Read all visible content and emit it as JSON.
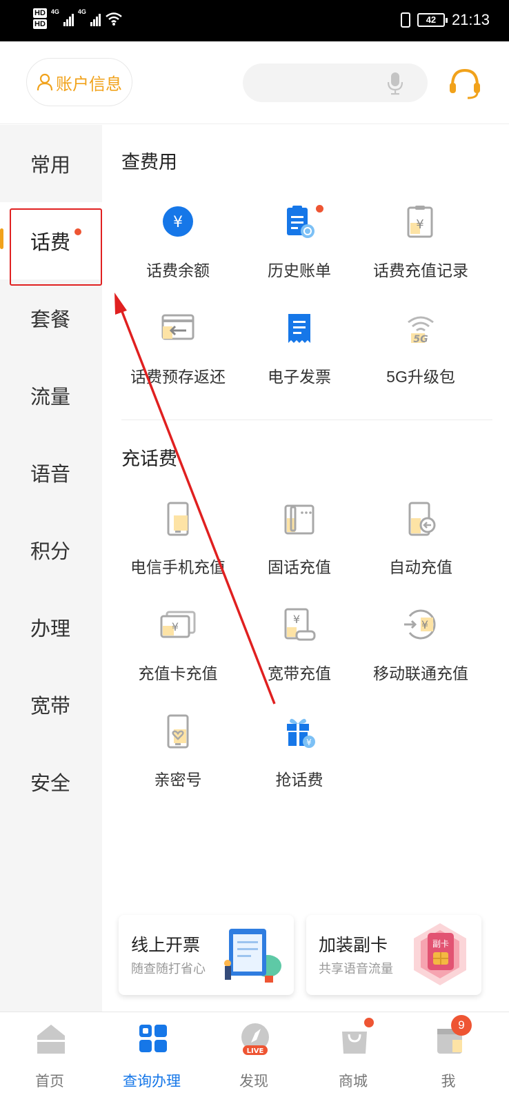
{
  "status_bar": {
    "hd1": "HD",
    "hd2": "HD",
    "net1": "4G",
    "net2": "4G",
    "battery": "42",
    "time": "21:13"
  },
  "header": {
    "account_label": "账户信息"
  },
  "sidebar": {
    "items": [
      {
        "label": "常用"
      },
      {
        "label": "话费"
      },
      {
        "label": "套餐"
      },
      {
        "label": "流量"
      },
      {
        "label": "语音"
      },
      {
        "label": "积分"
      },
      {
        "label": "办理"
      },
      {
        "label": "宽带"
      },
      {
        "label": "安全"
      }
    ],
    "active_index": 1
  },
  "sections": [
    {
      "title": "查费用",
      "items": [
        {
          "label": "话费余额",
          "icon": "yuan-circle-icon"
        },
        {
          "label": "历史账单",
          "icon": "bill-history-icon"
        },
        {
          "label": "话费充值记录",
          "icon": "recharge-record-icon"
        },
        {
          "label": "话费预存返还",
          "icon": "prestore-return-icon"
        },
        {
          "label": "电子发票",
          "icon": "e-invoice-icon"
        },
        {
          "label": "5G升级包",
          "icon": "5g-wifi-icon",
          "icon_text": "5G"
        }
      ]
    },
    {
      "title": "充话费",
      "items": [
        {
          "label": "电信手机充值",
          "icon": "phone-recharge-icon"
        },
        {
          "label": "固话充值",
          "icon": "landline-recharge-icon"
        },
        {
          "label": "自动充值",
          "icon": "auto-recharge-icon"
        },
        {
          "label": "充值卡充值",
          "icon": "card-recharge-icon"
        },
        {
          "label": "宽带充值",
          "icon": "broadband-recharge-icon"
        },
        {
          "label": "移动联通充值",
          "icon": "other-carrier-recharge-icon"
        },
        {
          "label": "亲密号",
          "icon": "intimate-number-icon"
        },
        {
          "label": "抢话费",
          "icon": "gift-icon"
        }
      ]
    }
  ],
  "promos": [
    {
      "title": "线上开票",
      "subtitle": "随查随打省心"
    },
    {
      "title": "加装副卡",
      "subtitle": "共享语音流量",
      "art_text": "副卡"
    }
  ],
  "bottom_nav": [
    {
      "label": "首页"
    },
    {
      "label": "查询办理"
    },
    {
      "label": "发现",
      "badge_text": "LIVE"
    },
    {
      "label": "商城"
    },
    {
      "label": "我",
      "badge_count": "9"
    }
  ],
  "colors": {
    "accent": "#f1a21b",
    "blue": "#1677e8",
    "badge": "#ee5533",
    "annotation": "#e02020"
  }
}
